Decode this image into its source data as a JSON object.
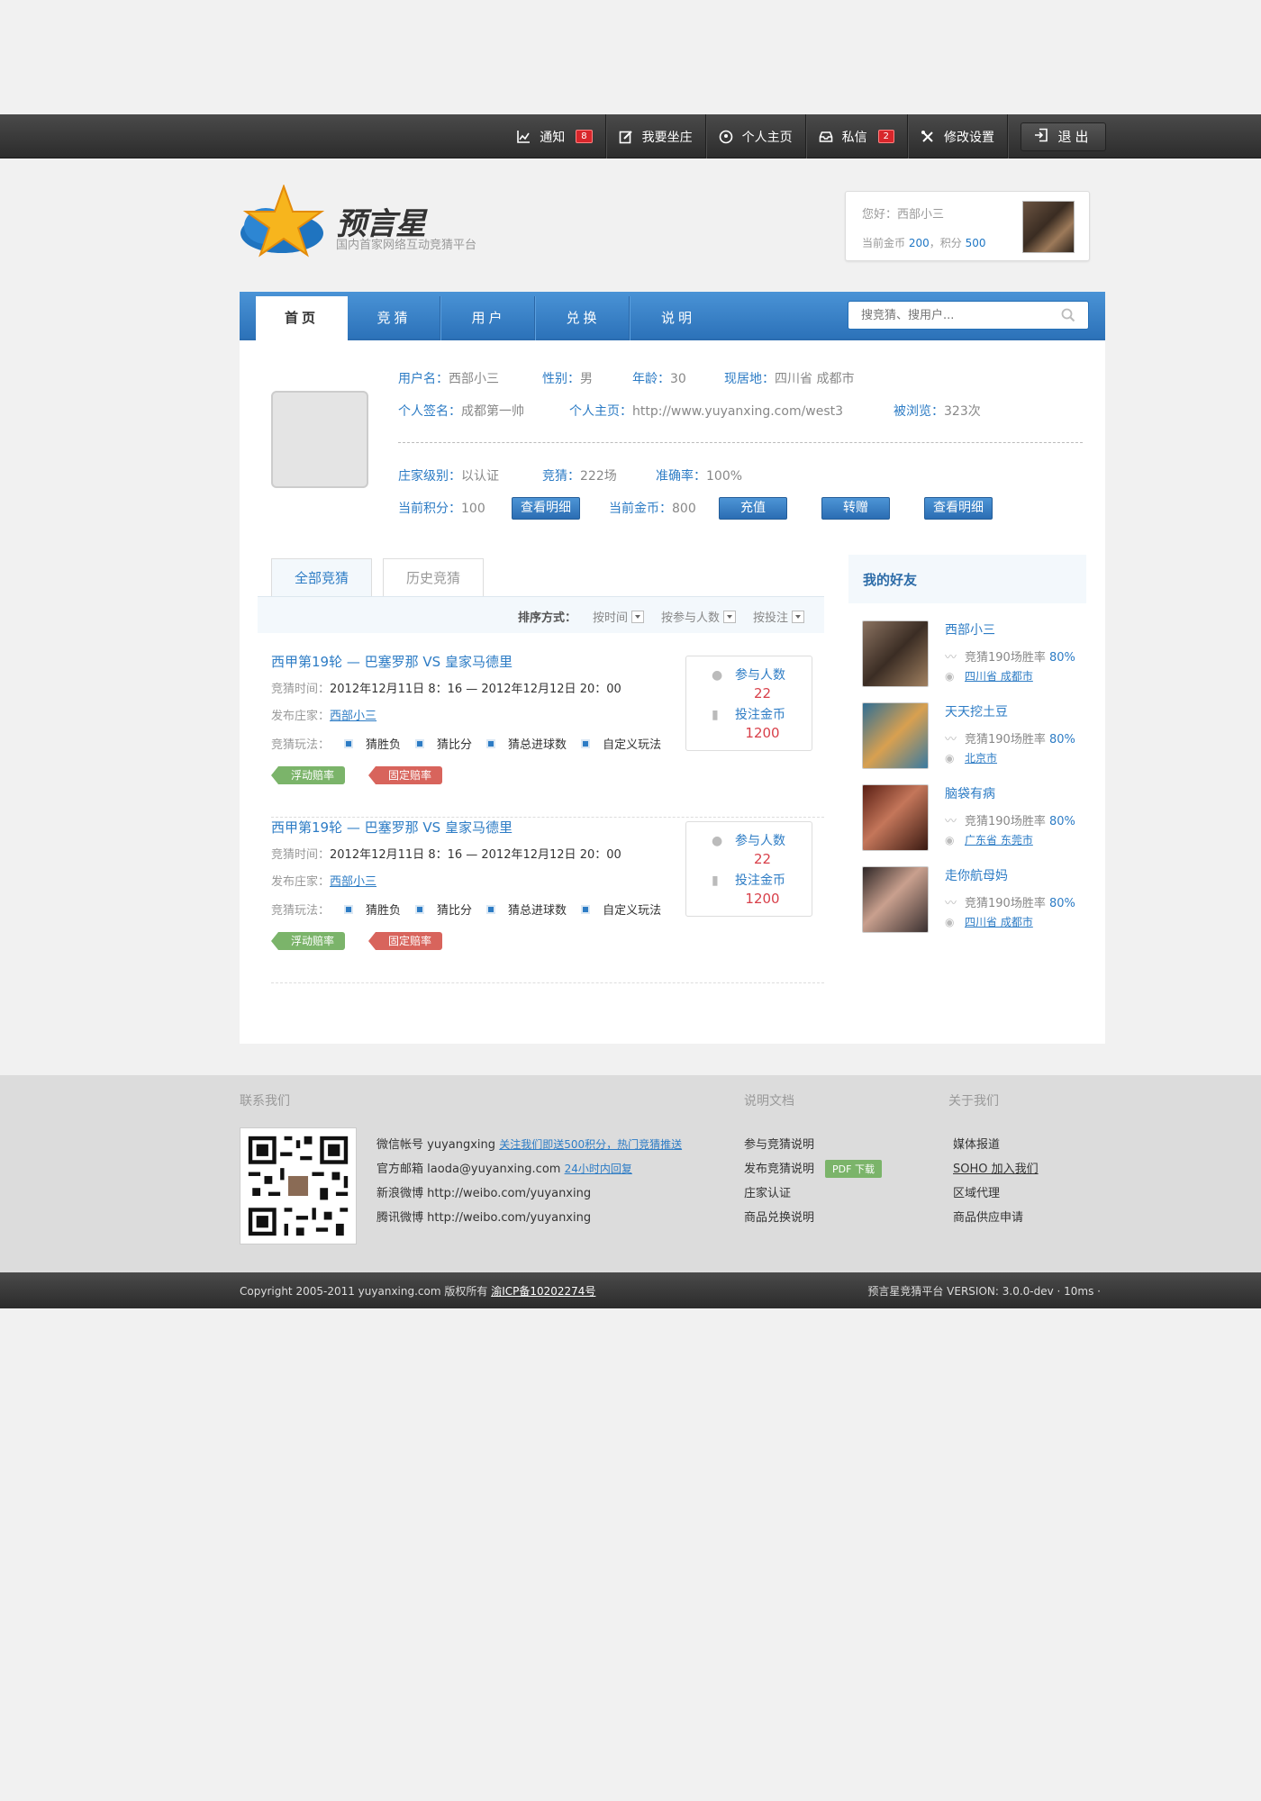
{
  "topbar": {
    "items": [
      {
        "label": "通知",
        "icon": "chart-icon",
        "badge": "8"
      },
      {
        "label": "我要坐庄",
        "icon": "edit-icon",
        "badge": ""
      },
      {
        "label": "个人主页",
        "icon": "home-icon",
        "badge": ""
      },
      {
        "label": "私信",
        "icon": "inbox-icon",
        "badge": "2"
      },
      {
        "label": "修改设置",
        "icon": "settings-icon",
        "badge": ""
      }
    ],
    "logout": "退出"
  },
  "brand": {
    "name": "预言星",
    "slogan": "国内首家网络互动竞猜平台"
  },
  "userbox": {
    "hello": "您好：西部小三",
    "coins_label": "当前金币",
    "coins": "200",
    "points_label": "，积分",
    "points": "500"
  },
  "nav": {
    "tabs": [
      "首页",
      "竞猜",
      "用户",
      "兑换",
      "说明"
    ],
    "search_placeholder": "搜竞猜、搜用户..."
  },
  "profile": {
    "username_k": "用户名：",
    "username": "西部小三",
    "gender_k": "性别：",
    "gender": "男",
    "age_k": "年龄：",
    "age": "30",
    "location_k": "现居地：",
    "location": "四川省 成都市",
    "sign_k": "个人签名：",
    "sign": "成都第一帅",
    "homepage_k": "个人主页：",
    "homepage": "http://www.yuyanxing.com/west3",
    "views_k": "被浏览：",
    "views": "323次",
    "level_k": "庄家级别：",
    "level": "以认证",
    "guess_k": "竞猜：",
    "guess": "222场",
    "acc_k": "准确率：",
    "acc": "100%",
    "points_k": "当前积分：",
    "points": "100",
    "coins_k": "当前金币：",
    "coins": "800",
    "btn_detail": "查看明细",
    "btn_recharge": "充值",
    "btn_transfer": "转赠",
    "btn_detail2": "查看明细"
  },
  "tabs": [
    "全部竞猜",
    "历史竞猜"
  ],
  "sort": {
    "label": "排序方式：",
    "options": [
      "按时间",
      "按参与人数",
      "按投注"
    ]
  },
  "matches": [
    {
      "title": "西甲第19轮 — 巴塞罗那 VS 皇家马德里",
      "time_k": "竞猜时间：",
      "time": "2012年12月11日 8：16 — 2012年12月12日 20：00",
      "host_k": "发布庄家：",
      "host": "西部小三",
      "play_k": "竞猜玩法：",
      "plays": [
        "猜胜负",
        "猜比分",
        "猜总进球数",
        "自定义玩法"
      ],
      "tag_float": "浮动赔率",
      "tag_fixed": "固定赔率",
      "participants_label": "参与人数",
      "participants": "22",
      "bet_label": "投注金币",
      "bet": "1200"
    },
    {
      "title": "西甲第19轮 — 巴塞罗那 VS 皇家马德里",
      "time_k": "竞猜时间：",
      "time": "2012年12月11日 8：16 — 2012年12月12日 20：00",
      "host_k": "发布庄家：",
      "host": "西部小三",
      "play_k": "竞猜玩法：",
      "plays": [
        "猜胜负",
        "猜比分",
        "猜总进球数",
        "自定义玩法"
      ],
      "tag_float": "浮动赔率",
      "tag_fixed": "固定赔率",
      "participants_label": "参与人数",
      "participants": "22",
      "bet_label": "投注金币",
      "bet": "1200"
    }
  ],
  "friends": {
    "title": "我的好友",
    "list": [
      {
        "name": "西部小三",
        "stat": "竞猜190场胜率",
        "rate": "80%",
        "loc": "四川省 成都市",
        "color": "#6a5646"
      },
      {
        "name": "天天挖土豆",
        "stat": "竞猜190场胜率",
        "rate": "80%",
        "loc": "北京市",
        "color": "#3e7fa6"
      },
      {
        "name": "脑袋有病",
        "stat": "竞猜190场胜率",
        "rate": "80%",
        "loc": "广东省 东莞市",
        "color": "#8a3a28"
      },
      {
        "name": "走你航母妈",
        "stat": "竞猜190场胜率",
        "rate": "80%",
        "loc": "四川省 成都市",
        "color": "#5f4a44"
      }
    ]
  },
  "footer": {
    "contact_title": "联系我们",
    "docs_title": "说明文档",
    "about_title": "关于我们",
    "contact": [
      {
        "k": "微信帐号",
        "v": "yuyangxing",
        "extra": "关注我们即送500积分，热门竞猜推送"
      },
      {
        "k": "官方邮箱",
        "v": "laoda@yuyanxing.com",
        "extra": "24小时内回复"
      },
      {
        "k": "新浪微博",
        "v": "http://weibo.com/yuyanxing",
        "extra": ""
      },
      {
        "k": "腾讯微博",
        "v": "http://weibo.com/yuyanxing",
        "extra": ""
      }
    ],
    "docs": [
      "参与竞猜说明",
      "发布竞猜说明",
      "庄家认证",
      "商品兑换说明"
    ],
    "pdf": "PDF 下载",
    "about": [
      "媒体报道",
      "SOHO 加入我们",
      "区域代理",
      "商品供应申请"
    ]
  },
  "bottombar": {
    "copyright": "Copyright 2005-2011 yuyanxing.com 版权所有",
    "icp": "渝ICP备10202274号",
    "version": "预言星竞猜平台  VERSION: 3.0.0-dev · 10ms ·"
  }
}
